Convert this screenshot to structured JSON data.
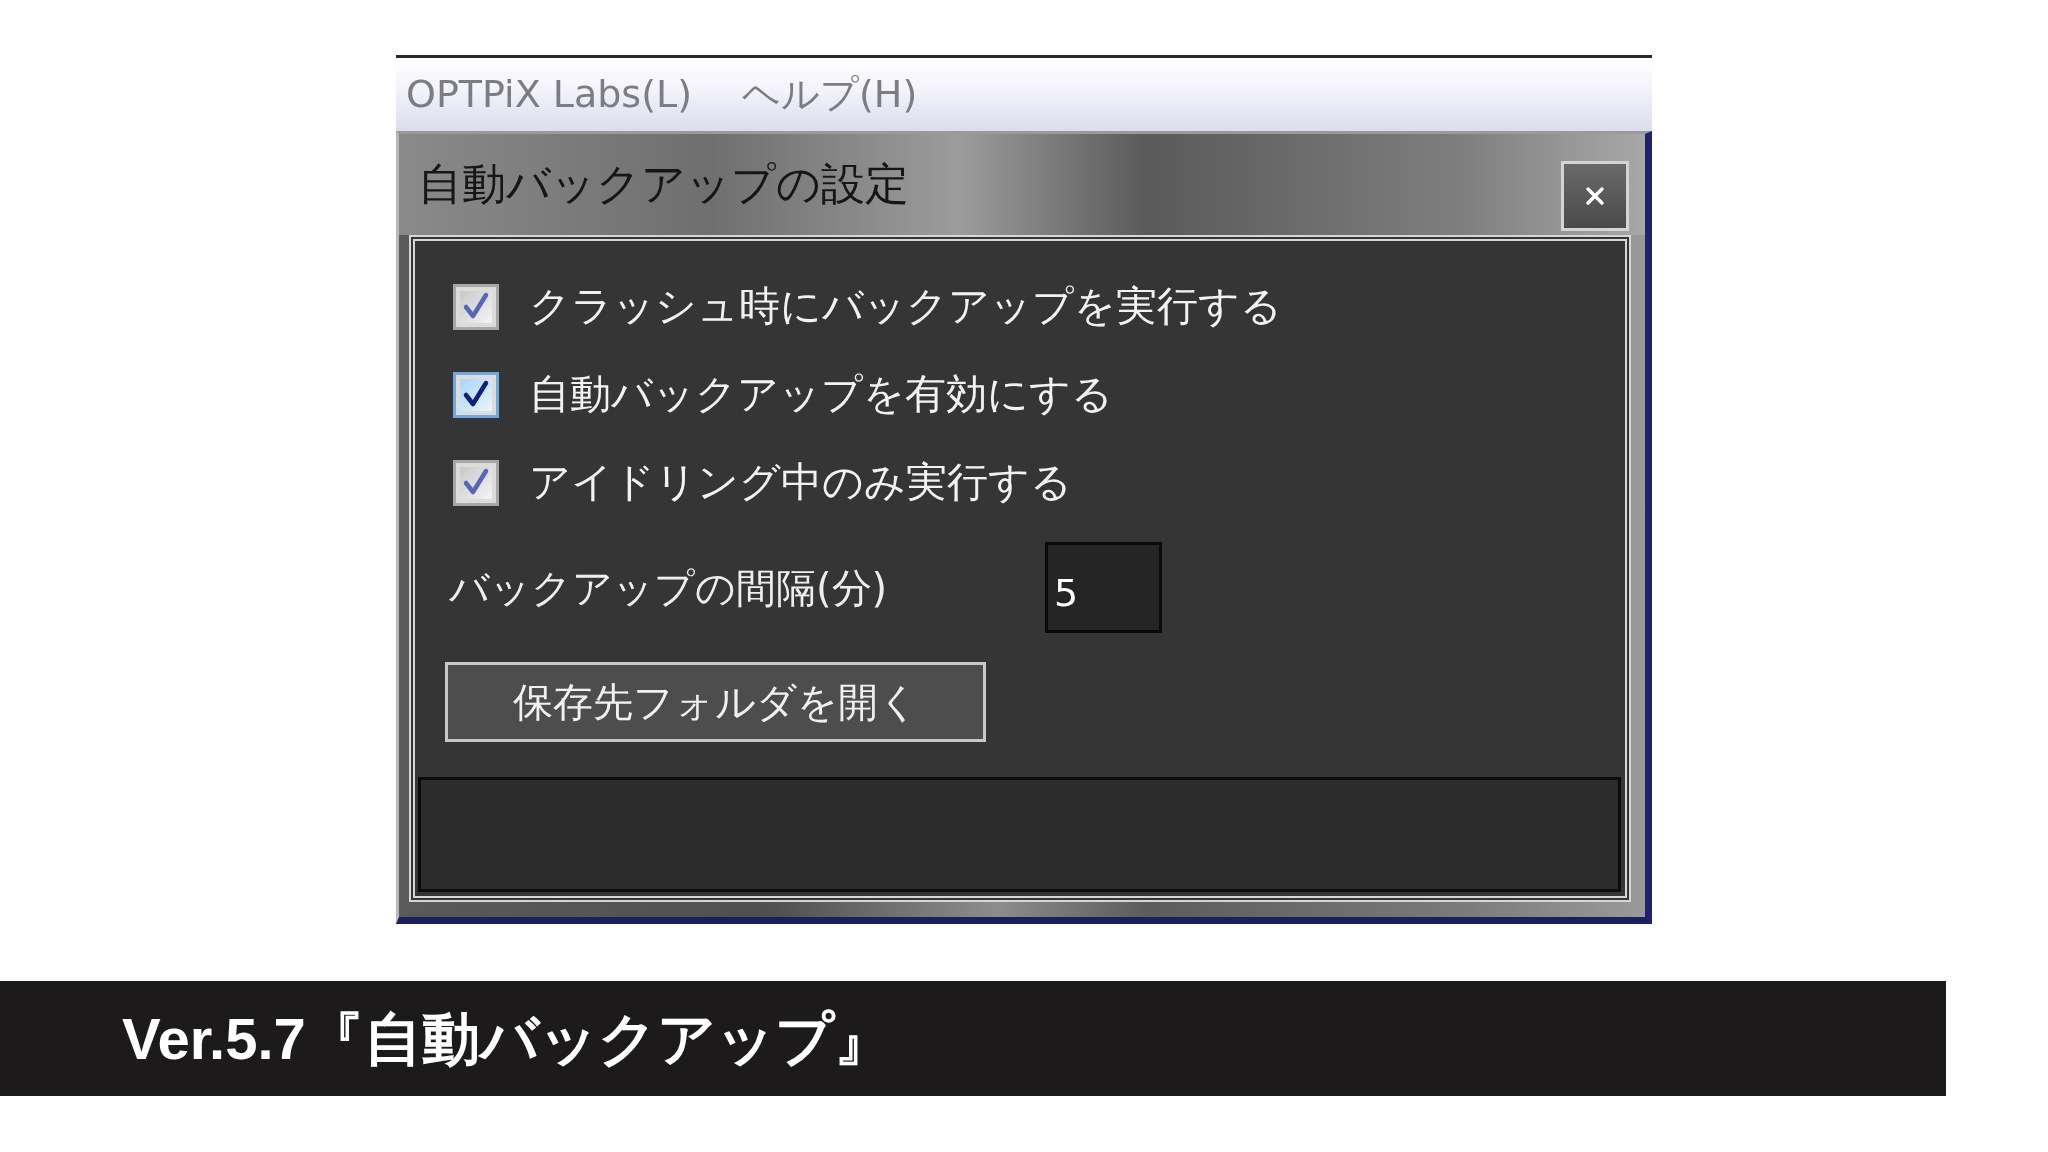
{
  "menu_bar": {
    "items": [
      {
        "label": "OPTPiX Labs(L)"
      },
      {
        "label": "ヘルプ(H)"
      }
    ]
  },
  "dialog": {
    "title": "自動バックアップの設定",
    "options": [
      {
        "label": "クラッシュ時にバックアップを実行する",
        "checked": true,
        "hovered": false
      },
      {
        "label": "自動バックアップを有効にする",
        "checked": true,
        "hovered": true
      },
      {
        "label": "アイドリング中のみ実行する",
        "checked": true,
        "hovered": false
      }
    ],
    "interval": {
      "label": "バックアップの間隔(分)",
      "value": "5"
    },
    "open_folder_button": {
      "label": "保存先フォルダを開く"
    }
  },
  "caption": {
    "text": "Ver.5.7『自動バックアップ』"
  }
}
